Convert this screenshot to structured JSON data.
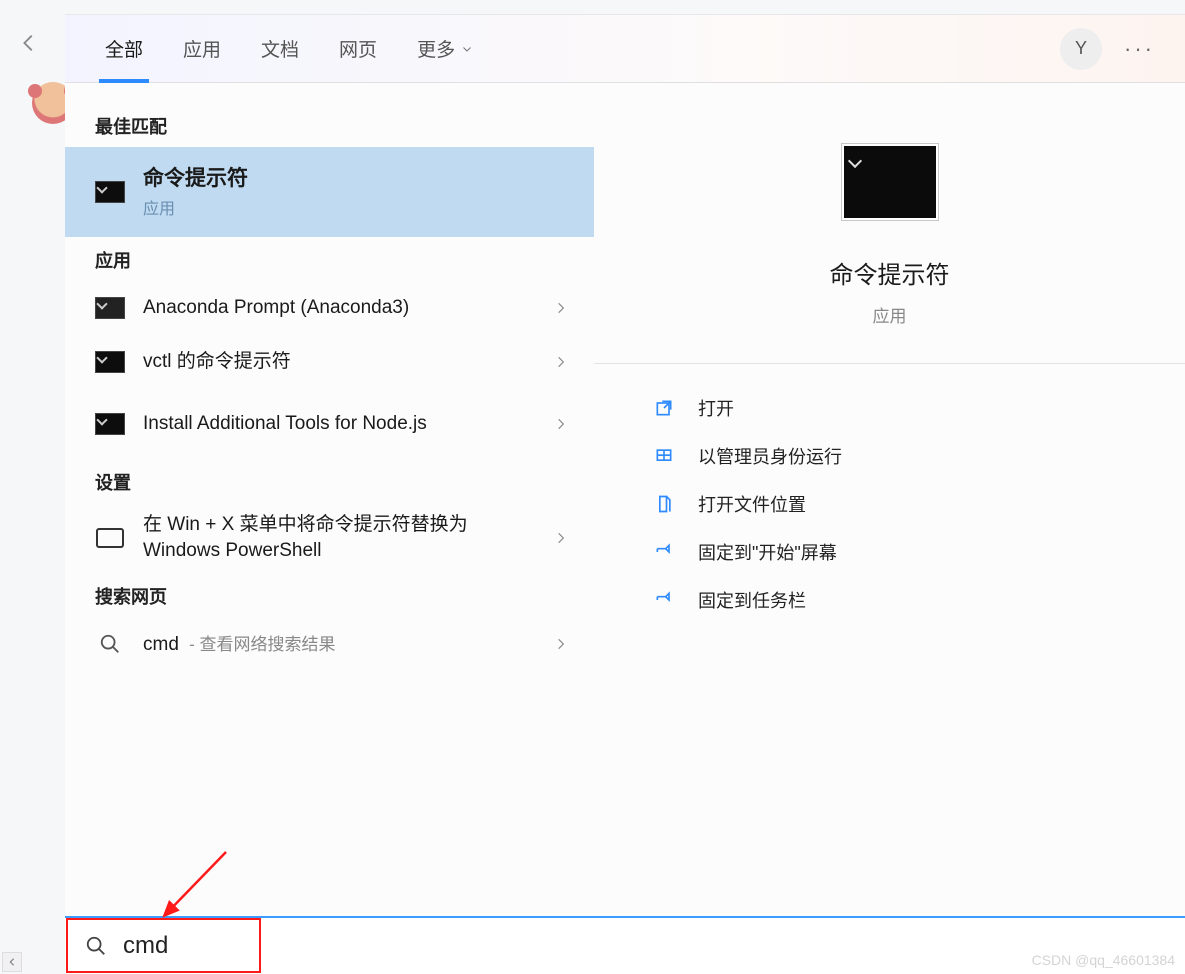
{
  "tabs": {
    "all": "全部",
    "apps": "应用",
    "docs": "文档",
    "web": "网页",
    "more": "更多"
  },
  "user_initial": "Y",
  "left": {
    "best_match_header": "最佳匹配",
    "best_match": {
      "title": "命令提示符",
      "sub": "应用"
    },
    "apps_header": "应用",
    "apps": [
      {
        "title": "Anaconda Prompt (Anaconda3)"
      },
      {
        "title": "vctl 的命令提示符"
      },
      {
        "title": "Install Additional Tools for Node.js"
      }
    ],
    "settings_header": "设置",
    "settings": [
      {
        "title": "在 Win + X 菜单中将命令提示符替换为 Windows PowerShell"
      }
    ],
    "web_header": "搜索网页",
    "web": {
      "term": "cmd",
      "desc": "- 查看网络搜索结果"
    }
  },
  "preview": {
    "title": "命令提示符",
    "sub": "应用",
    "actions": {
      "open": "打开",
      "admin": "以管理员身份运行",
      "location": "打开文件位置",
      "pin_start": "固定到\"开始\"屏幕",
      "pin_taskbar": "固定到任务栏"
    }
  },
  "search": {
    "value": "cmd"
  },
  "watermark": "CSDN @qq_46601384"
}
